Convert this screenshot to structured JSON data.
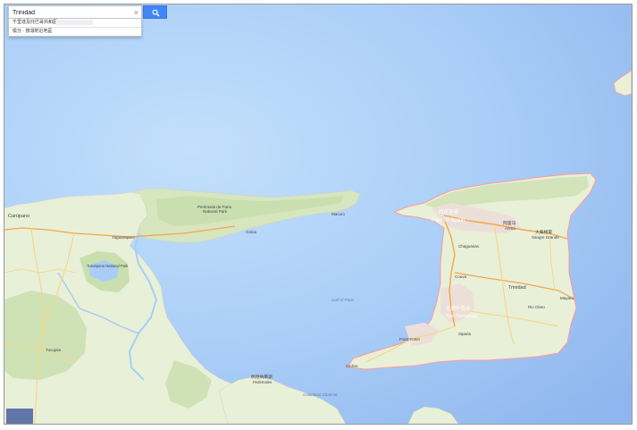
{
  "search": {
    "query": "Trinidad",
    "clear_symbol": "×",
    "suggestions": [
      "千里達及托巴哥共和國",
      "檢分 · 搜尋附近地區"
    ]
  },
  "map": {
    "colors": {
      "water": "#a9cdf7",
      "land": "#e8f0d8",
      "forest": "#cfe2b5",
      "urban": "#ecdfd9",
      "coast_border": "#ff9a9a",
      "major_road": "#f5a54a",
      "minor_road": "#fbd47a"
    },
    "labels": {
      "carupano": "Carúpano",
      "paria_peninsula": "Península de Paria\nNational Park",
      "guiria": "Güiria",
      "gulf_of_paria": "Gulf of Paria",
      "macuro": "Macuro",
      "port_of_spain": "Port of Spain",
      "port_of_spain_local": "西班牙港",
      "arima": "Arima",
      "arima_local": "阿里马",
      "sangre_grande": "Sangre Grande",
      "sangre_grande_local": "大桑格雷",
      "chaguanas": "Chaguanas",
      "couva": "Couva",
      "san_fernando": "San Fernando",
      "san_fernando_local": "圣费尔南多",
      "trinidad": "Trinidad",
      "rio_claro": "Rio Claro",
      "mayaro": "Mayaro",
      "point_fortin": "Point Fortin",
      "siparia": "Siparia",
      "yaguaraparo": "Yaguaraparo",
      "turuepano": "Turuépano National Park",
      "tucupita": "Tucupita",
      "pedernales": "Pedernales",
      "pedernales_local": "佩德纳莱斯",
      "columbus_channel": "Columbus Channel",
      "cedros": "Cedros"
    }
  }
}
